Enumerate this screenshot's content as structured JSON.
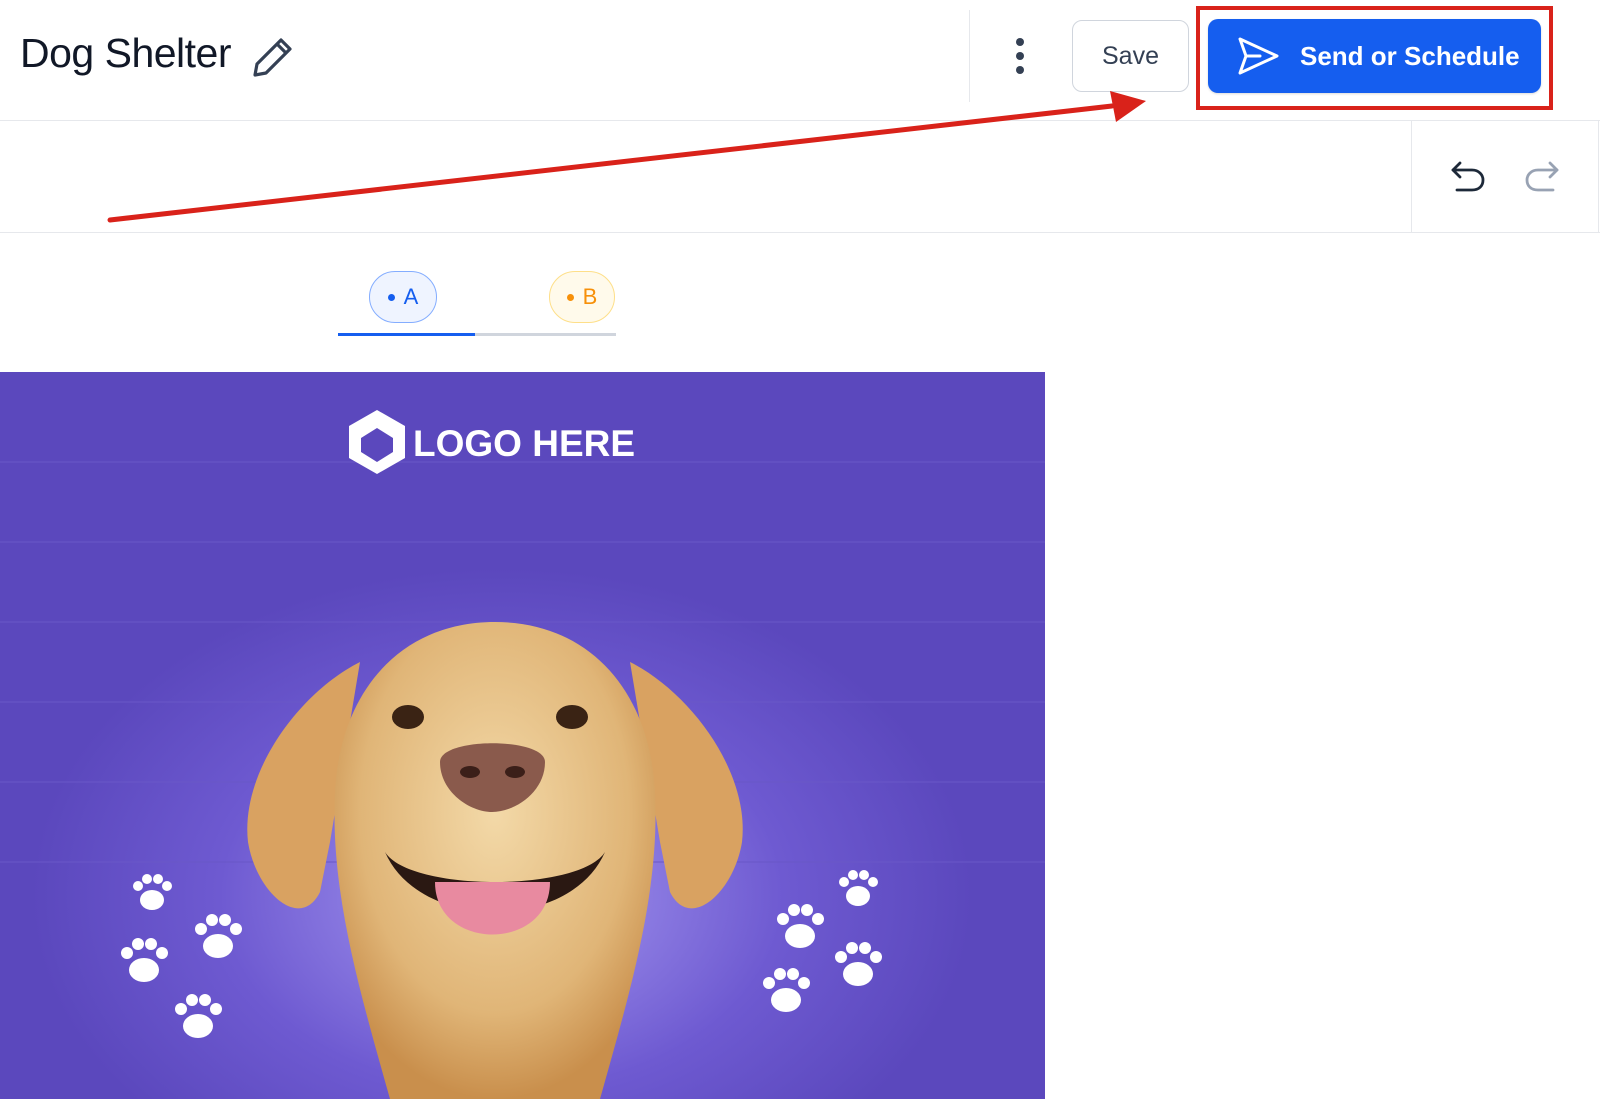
{
  "header": {
    "title": "Dog Shelter",
    "edit_icon": "pencil-icon",
    "more_icon": "kebab-menu-icon",
    "save_label": "Save",
    "send_label": "Send or Schedule",
    "send_icon": "paper-plane-icon"
  },
  "toolbar": {
    "undo_icon": "undo-icon",
    "redo_icon": "redo-icon"
  },
  "variants": {
    "tabs": [
      {
        "label": "A",
        "active": true
      },
      {
        "label": "B",
        "active": false
      }
    ]
  },
  "email_preview": {
    "logo_text": "LOGO HERE",
    "background_color": "#5b48bd"
  },
  "colors": {
    "accent": "#155eef",
    "annotation": "#d9221a",
    "variant_b": "#f79009"
  }
}
